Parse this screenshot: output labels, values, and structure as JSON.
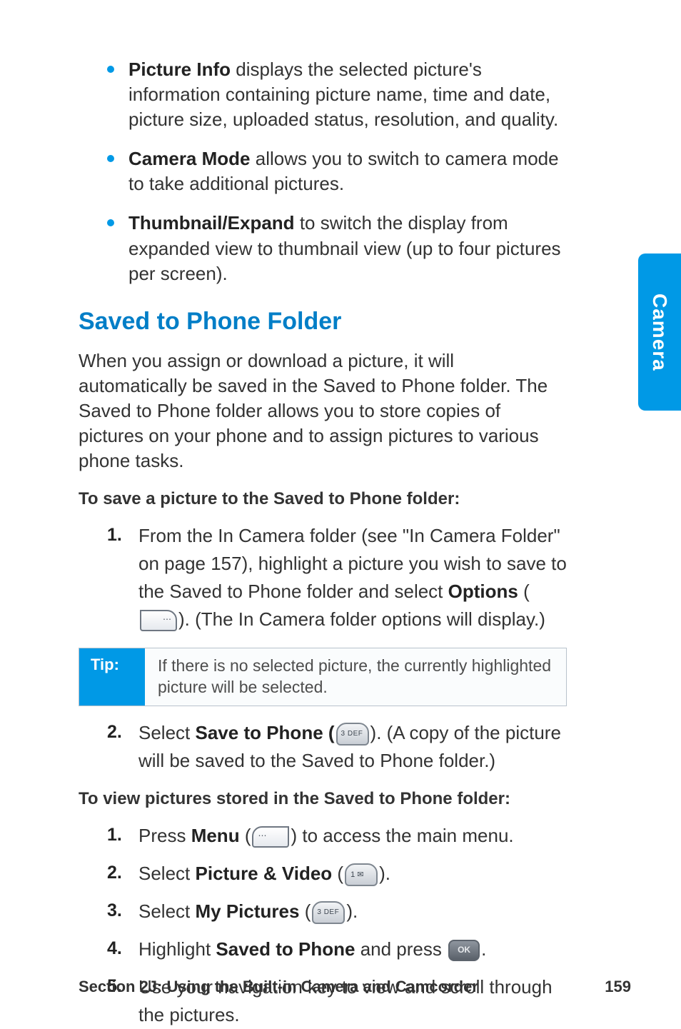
{
  "side_tab": "Camera",
  "bullets": [
    {
      "term": "Picture Info",
      "desc": " displays the selected picture's information containing picture name, time and date, picture size, uploaded status, resolution, and quality."
    },
    {
      "term": "Camera Mode",
      "desc": " allows you to switch to camera mode to take additional pictures."
    },
    {
      "term": "Thumbnail/Expand",
      "desc": " to switch the display from expanded view to thumbnail view (up to four pictures per screen)."
    }
  ],
  "heading": "Saved to Phone Folder",
  "intro": "When you assign or download a picture, it will automatically be saved in the Saved to Phone folder. The Saved to Phone folder allows you to store copies of pictures on your phone and to assign pictures to various phone tasks.",
  "sub_save": "To save a picture to the Saved to Phone folder:",
  "steps_save": [
    {
      "a": "From the In Camera folder (see \"In Camera Folder\" on page 157), highlight a picture you wish to save to the Saved to Phone folder and select ",
      "b": "Options",
      "c": " (",
      "d": "). (The In Camera folder options will display.)"
    }
  ],
  "tip": {
    "label": "Tip:",
    "text": "If there is no selected picture, the currently highlighted picture will be selected."
  },
  "steps_save2": [
    {
      "a": "Select ",
      "b": "Save to Phone (",
      "c": "). (A copy of the picture will be saved to the Saved to Phone folder.)"
    }
  ],
  "sub_view": "To view pictures stored in the Saved to Phone folder:",
  "steps_view": [
    {
      "a": "Press ",
      "b": "Menu",
      "c": " (",
      "d": ") to access the main menu."
    },
    {
      "a": "Select ",
      "b": "Picture & Video",
      "c": " (",
      "d": ")."
    },
    {
      "a": "Select ",
      "b": "My Pictures",
      "c": " (",
      "d": ")."
    },
    {
      "a": "Highlight ",
      "b": "Saved to Phone",
      "c": " and press ",
      "d": "."
    },
    {
      "a": "Use your navigation key to view and scroll through the pictures."
    }
  ],
  "footer": {
    "section": "Section 2J: Using the Built-in Camera and Camcorder",
    "page": "159"
  }
}
